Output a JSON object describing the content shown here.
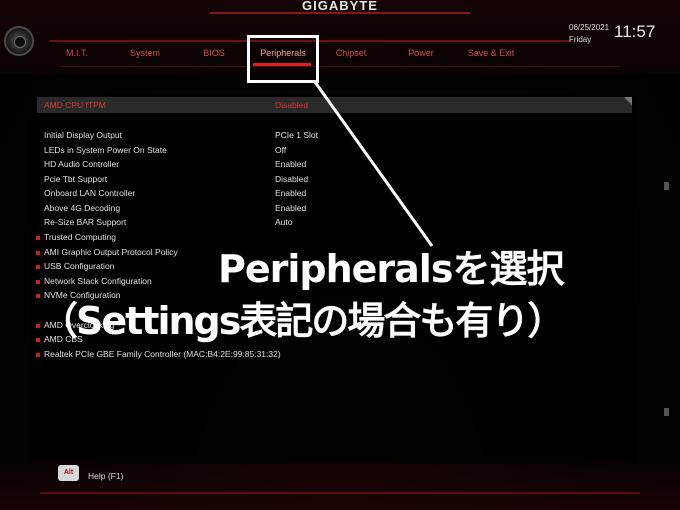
{
  "header": {
    "brand": "GIGABYTE",
    "date": "06/25/2021",
    "day": "Friday",
    "time": "11:57",
    "tabs": [
      {
        "label": "M.I.T."
      },
      {
        "label": "System"
      },
      {
        "label": "BIOS"
      },
      {
        "label": "Peripherals"
      },
      {
        "label": "Chipset"
      },
      {
        "label": "Power"
      },
      {
        "label": "Save & Exit"
      }
    ],
    "active_tab": "Peripherals"
  },
  "settings": [
    {
      "label": "AMD CPU fTPM",
      "value": "Disabled"
    },
    {
      "label": "Initial Display Output",
      "value": "PCIe 1 Slot"
    },
    {
      "label": "LEDs in System Power On State",
      "value": "Off"
    },
    {
      "label": "HD Audio Controller",
      "value": "Enabled"
    },
    {
      "label": "Pcie Tbt Support",
      "value": "Disabled"
    },
    {
      "label": "Onboard LAN Controller",
      "value": "Enabled"
    },
    {
      "label": "Above 4G Decoding",
      "value": "Enabled"
    },
    {
      "label": "Re-Size BAR Support",
      "value": "Auto"
    }
  ],
  "submenus": [
    {
      "label": "Trusted Computing"
    },
    {
      "label": "AMI Graphic Output Protocol Policy"
    },
    {
      "label": "USB Configuration"
    },
    {
      "label": "Network Stack Configuration"
    },
    {
      "label": "NVMe Configuration"
    },
    {
      "label": "AMD Overclocking"
    },
    {
      "label": "AMD CBS"
    },
    {
      "label": "Realtek PCIe GBE Family Controller (MAC:B4:2E:99:85:31:32)"
    }
  ],
  "footer": {
    "alt_key": "Alt",
    "help": "Help (F1)"
  },
  "annotation": {
    "line1": "Peripheralsを選択",
    "line2": "（Settings表記の場合も有り）"
  },
  "colors": {
    "accent_red": "#d93a2a",
    "highlight_row": "#2a2a2a",
    "annotation": "#ffffff"
  }
}
